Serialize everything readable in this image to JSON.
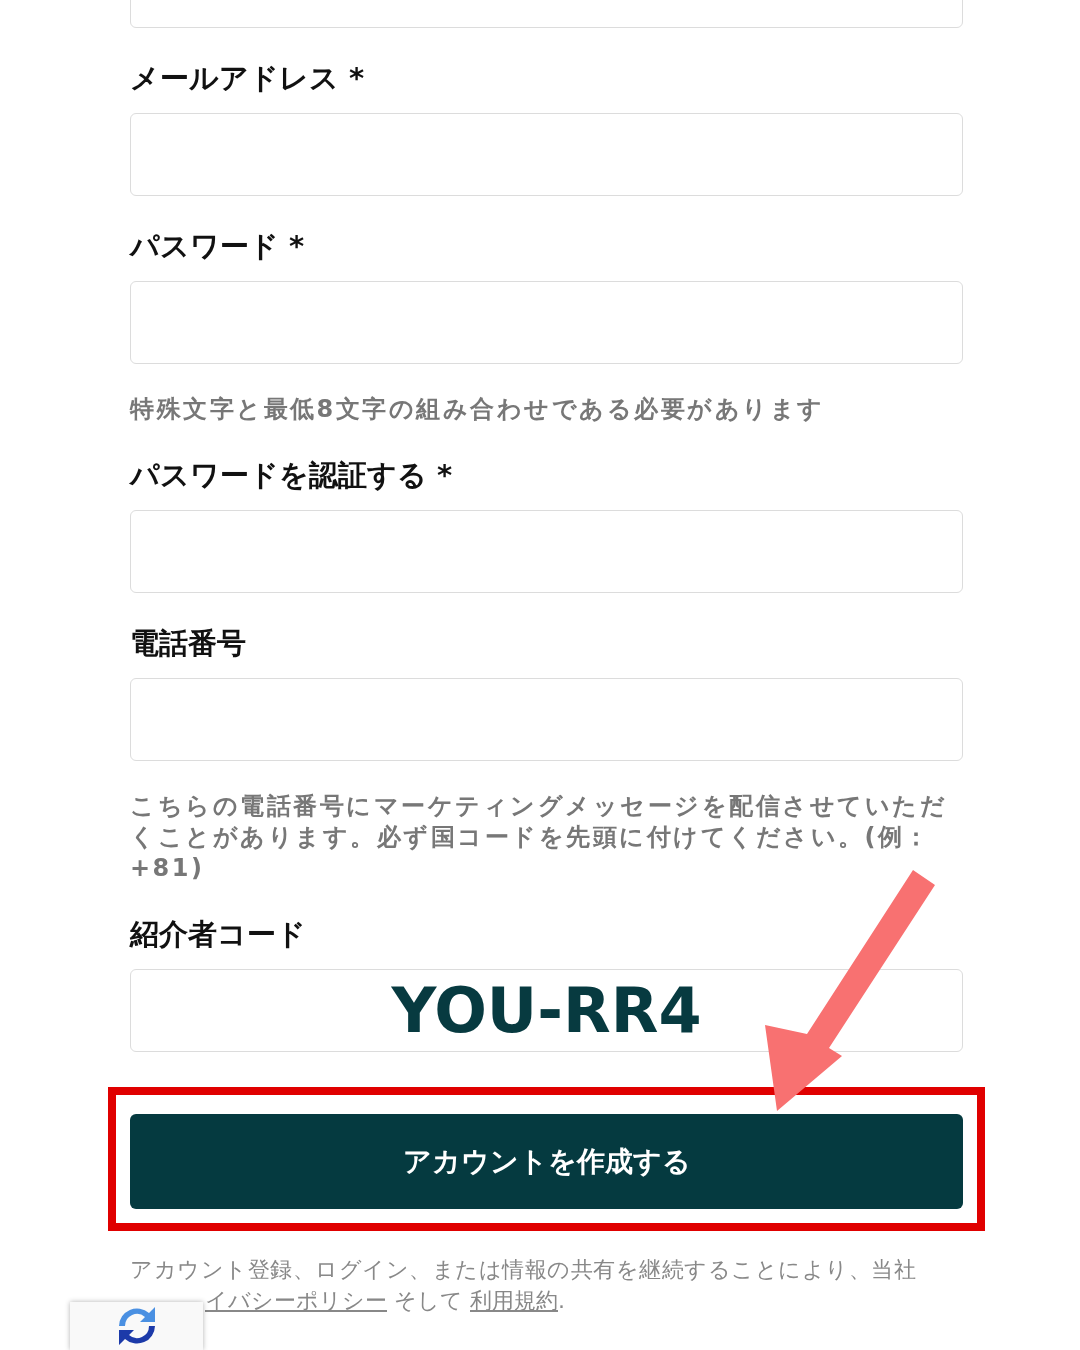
{
  "fields": [
    {
      "label": "メールアドレス *"
    },
    {
      "label": "パスワード *",
      "hint": "特殊文字と最低8文字の組み合わせである必要があります"
    },
    {
      "label": "パスワードを認証する *"
    },
    {
      "label": "電話番号",
      "hint": "こちらの電話番号にマーケティングメッセージを配信させていただくことがあります。必ず国コードを先頭に付けてください。(例：+81)"
    },
    {
      "label": "紹介者コード",
      "annotation": "YOU-RR4"
    }
  ],
  "submit_button": "アカウントを作成する",
  "footer": {
    "line_1": "アカウント登録、ログイン、または情報の共有を継続することにより、当社",
    "privacy_link": "イバシーポリシー",
    "joiner": " そして ",
    "terms_link": "利用規約",
    "end": "."
  }
}
